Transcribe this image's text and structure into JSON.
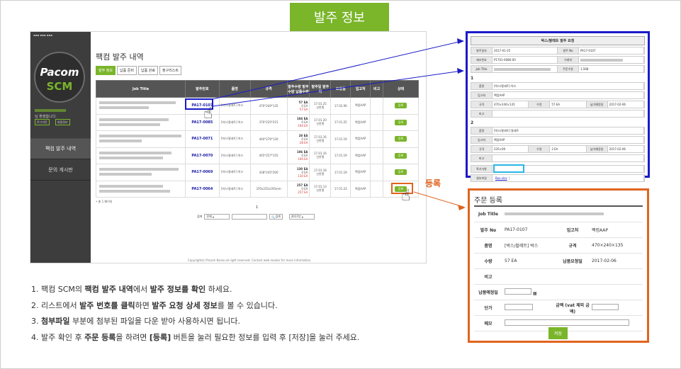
{
  "banner": {
    "title": "발주 정보"
  },
  "sidebar": {
    "logo_top": "Pacom",
    "logo_bottom": "SCM",
    "greeting": "님 환영합니다.",
    "logout": "로그아웃",
    "info": "회원정보",
    "menu1": "팩컴 발주 내역",
    "menu2": "문의 게시판"
  },
  "main": {
    "title": "팩컴 발주 내역",
    "tabs": [
      "발주 정보",
      "납품 준비",
      "납품 완료",
      "청구리스트"
    ],
    "headers": [
      "Job Title",
      "발주번호",
      "품명",
      "규격",
      "발주수량 발주수량 납품수량",
      "발주일 발주자",
      "요청일",
      "입고처",
      "비고",
      "상태"
    ],
    "rows": [
      {
        "no": "PA17-0107",
        "name": "[박스/팔레트] 박스",
        "spec": "470*240*135",
        "q1": "57 EA",
        "q2": "0 EA",
        "q3": "57 EA",
        "d1": "17.01.25",
        "who": "신한철",
        "req": "17.02.06",
        "wh": "팩컴AAP",
        "state": "등록"
      },
      {
        "no": "PA17-0085",
        "name": "[박스/팔레트] 박스",
        "spec": "370*235*215",
        "q1": "104 EA",
        "q2": "0 EA",
        "q3": "194 EA",
        "d1": "17.01.20",
        "who": "신한철",
        "req": "17.01.25",
        "wh": "팩컴AAP",
        "state": "등록"
      },
      {
        "no": "PA17-0071",
        "name": "[박스/팔레트] 박스",
        "spec": "440*276*130",
        "q1": "28 EA",
        "q2": "0 EA",
        "q3": "28 EA",
        "d1": "17.01.16",
        "who": "신한철",
        "req": "17.01.19",
        "wh": "팩컴AAP",
        "state": "등록"
      },
      {
        "no": "PA17-0070",
        "name": "[박스/팔레트] 박스",
        "spec": "405*257*155",
        "q1": "106 EA",
        "q2": "0 EA",
        "q3": "106 EA",
        "d1": "17.01.16",
        "who": "신한철",
        "req": "17.01.19",
        "wh": "팩컴AAP",
        "state": "등록"
      },
      {
        "no": "PA17-0069",
        "name": "[박스/팔레트] 박스",
        "spec": "438*245*200",
        "q1": "130 EA",
        "q2": "0 EA",
        "q3": "130 EA",
        "d1": "17.01.16",
        "who": "신한철",
        "req": "17.01.19",
        "wh": "팩컴AAP",
        "state": "등록"
      },
      {
        "no": "PA17-0064",
        "name": "[박스/팔레트] 박스",
        "spec": "370x235x195mm",
        "q1": "257 EA",
        "q2": "0 EA",
        "q3": "257 EA",
        "d1": "17.01.13",
        "who": "신한철",
        "req": "17.01.23",
        "wh": "팩컴AAP",
        "state": "등록"
      }
    ],
    "total": "• 총 1 페이지",
    "pager": "1",
    "search_select": "전체",
    "search_btn": "검색",
    "year": "2017년",
    "copyright": "Copyright(c) Pacom Korea all right reserved. Contact web master for more information."
  },
  "detail": {
    "title": "박스/팔레트 발주 요청",
    "r1": [
      "발주일자",
      "2017-01-25",
      "발주 No",
      "PA17-0107"
    ],
    "r2": [
      "제조번호",
      "P1701-0086-00",
      "거래처",
      ""
    ],
    "r3": [
      "Job Title",
      "",
      "주문수량",
      "1,568"
    ],
    "s1": "1",
    "s1r": [
      [
        "품명",
        "[박스/팔레트] 박스"
      ],
      [
        "입고처",
        "팩컴AAP"
      ]
    ],
    "s1spec": [
      "규격",
      "470×240×135",
      "수량",
      "57 EA",
      "납기예정일",
      "2017-02-06"
    ],
    "s1note": "비고",
    "s2": "2",
    "s2r": [
      [
        "품명",
        "[박스/팔레트] 팔레트"
      ],
      [
        "입고처",
        "팩컴AAP"
      ]
    ],
    "s2spec": [
      "규격",
      "235×09",
      "수량",
      "2 EA",
      "납기예정일",
      "2017-02-06"
    ],
    "s2note": "비고",
    "etc": "특기사항",
    "attach_label": "첨부파일",
    "attach": "Box.xlsx"
  },
  "reg_label": "등록",
  "order": {
    "title": "주문 등록",
    "jobtitle": "Job Title",
    "no_label": "발주 No",
    "no": "PA17-0107",
    "wh_label": "입고처",
    "wh": "팩컴AAP",
    "name_label": "품명",
    "name": "[박스/팔레트] 박스",
    "spec_label": "규격",
    "spec": "470×240×135",
    "qty_label": "수량",
    "qty": "57 EA",
    "req_label": "납품요청일",
    "req": "2017-02-06",
    "note_label": "비고",
    "due_label": "납품예정일",
    "price_label": "단가",
    "amount_label": "금액 (vat 제외 금액)",
    "memo_label": "메모",
    "save": "저장"
  },
  "steps": [
    [
      "1. 팩컴 SCM의 ",
      "팩컴 발주 내역",
      "에서 ",
      "발주 정보를 확인",
      " 하세요."
    ],
    [
      "2. 리스트에서 ",
      "발주 번호를 클릭",
      "하면 ",
      "발주 요청 상세 정보",
      "를 볼 수 있습니다."
    ],
    [
      "3. ",
      "첨부파일",
      " 부분에 첨부된 파일을 다운 받아 사용하시면 됩니다.",
      "",
      ""
    ],
    [
      "4. 발주 확인 후 ",
      "주문 등록",
      "을 하려면 ",
      "[등록]",
      " 버튼을 눌러 필요한 정보를 입력 후 [저장]을 눌러 주세요."
    ]
  ]
}
